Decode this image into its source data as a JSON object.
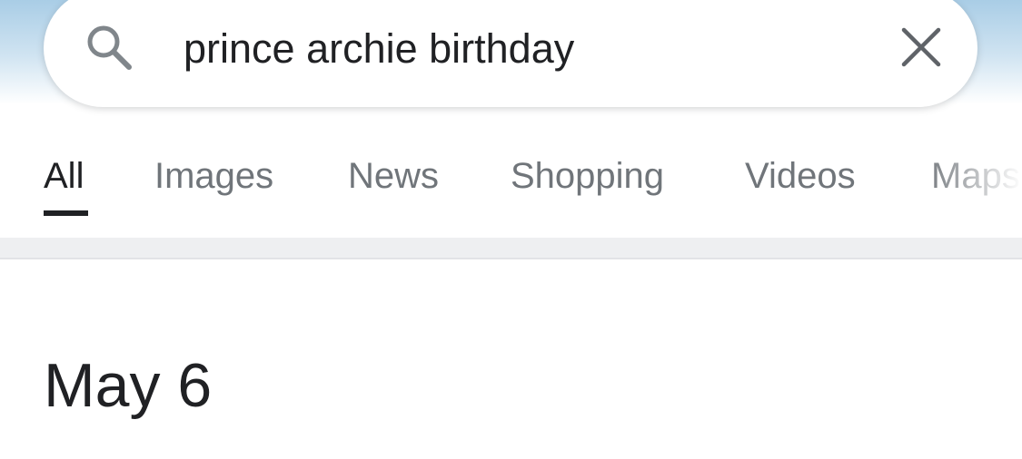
{
  "search": {
    "query": "prince archie birthday",
    "icon": "search-icon",
    "clear_icon": "close-icon"
  },
  "tabs": [
    {
      "label": "All",
      "active": true
    },
    {
      "label": "Images",
      "active": false
    },
    {
      "label": "News",
      "active": false
    },
    {
      "label": "Shopping",
      "active": false
    },
    {
      "label": "Videos",
      "active": false
    },
    {
      "label": "Maps",
      "active": false
    }
  ],
  "result": {
    "answer": "May 6"
  },
  "colors": {
    "text_primary": "#202124",
    "text_secondary": "#70757a",
    "header_gradient_top": "#a9cde6",
    "separator": "#eeeff1"
  }
}
